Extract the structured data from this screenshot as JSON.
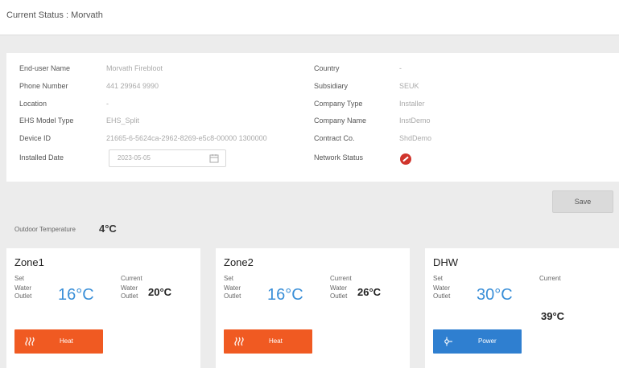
{
  "header": {
    "title": "Current Status : Morvath"
  },
  "info": {
    "left": [
      {
        "label": "End-user Name",
        "value": "Morvath Firebloot"
      },
      {
        "label": "Phone Number",
        "value": "441 29964 9990"
      },
      {
        "label": "Location",
        "value": "-"
      },
      {
        "label": "EHS Model Type",
        "value": "EHS_Split"
      },
      {
        "label": "Device ID",
        "value": "21665-6-5624ca-2962-8269-e5c8-00000 1300000"
      },
      {
        "label": "Installed Date",
        "value": "2023-05-05"
      }
    ],
    "right": [
      {
        "label": "Country",
        "value": "-"
      },
      {
        "label": "Subsidiary",
        "value": "SEUK"
      },
      {
        "label": "Company Type",
        "value": "Installer"
      },
      {
        "label": "Company Name",
        "value": "InstDemo"
      },
      {
        "label": "Contract Co.",
        "value": "ShdDemo"
      },
      {
        "label": "Network Status",
        "value": ""
      }
    ],
    "network_status_color": "#d0342c"
  },
  "actions": {
    "save_label": "Save"
  },
  "outdoor": {
    "label": "Outdoor Temperature",
    "value": "4°C"
  },
  "zones": [
    {
      "name": "Zone1",
      "set_label": "Set",
      "outlet_label": "Water Outlet",
      "set_temp": "16°C",
      "current_label": "Current",
      "current_outlet_label": "Water Outlet",
      "current_temp": "20°C",
      "button_label": "Heat",
      "button_color": "#f05a22",
      "button_icon": "heat-icon"
    },
    {
      "name": "Zone2",
      "set_label": "Set",
      "outlet_label": "Water Outlet",
      "set_temp": "16°C",
      "current_label": "Current",
      "current_outlet_label": "Water Outlet",
      "current_temp": "26°C",
      "button_label": "Heat",
      "button_color": "#f05a22",
      "button_icon": "heat-icon"
    },
    {
      "name": "DHW",
      "set_label": "Set",
      "outlet_label": "Water Outlet",
      "set_temp": "30°C",
      "current_label": "Current",
      "current_temp": "39°C",
      "button_label": "Power",
      "button_color": "#2f7fd0",
      "button_icon": "power-icon"
    }
  ],
  "colors": {
    "accent_blue": "#3a8fd8",
    "heat_orange": "#f05a22",
    "power_blue": "#2f7fd0"
  }
}
